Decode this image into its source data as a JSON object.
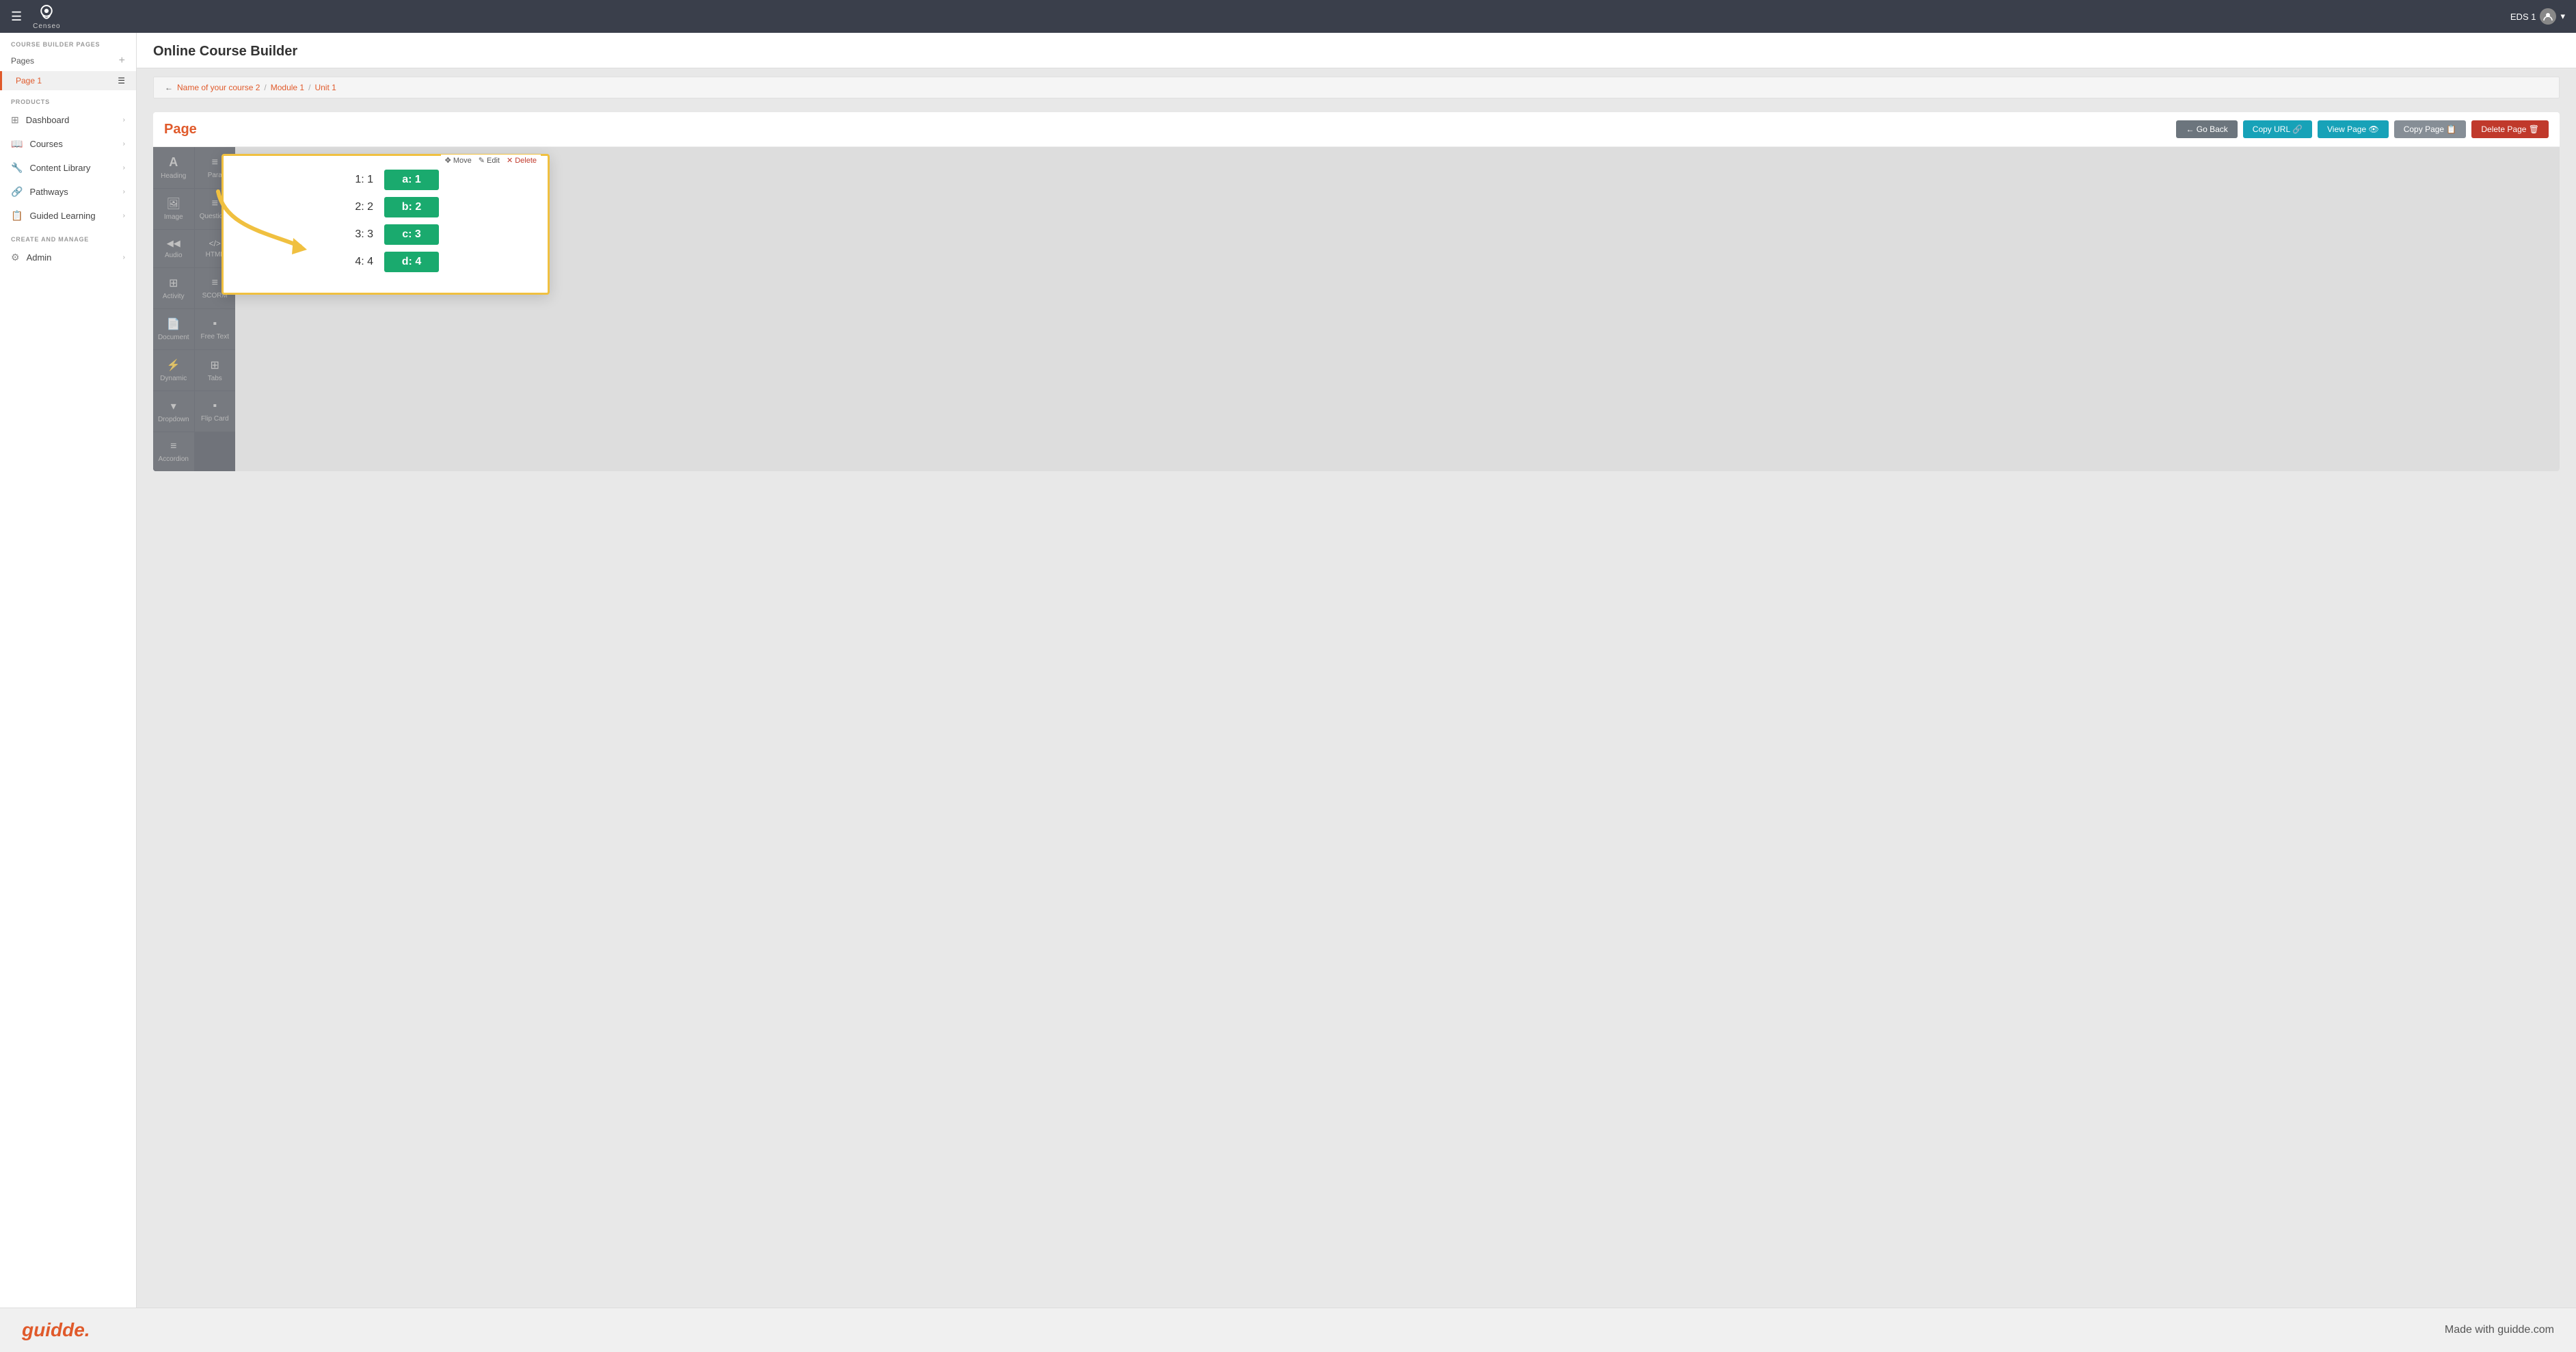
{
  "app": {
    "name": "Censeo",
    "hamburger_icon": "☰"
  },
  "topnav": {
    "user_label": "EDS 1",
    "dropdown_icon": "▾"
  },
  "sidebar": {
    "section_course_builder": "Course Builder Pages",
    "pages_label": "Pages",
    "page1_label": "Page 1",
    "section_products": "Products",
    "section_create": "Create and Manage",
    "items": [
      {
        "id": "dashboard",
        "label": "Dashboard",
        "icon": "⊞"
      },
      {
        "id": "courses",
        "label": "Courses",
        "icon": "📖"
      },
      {
        "id": "content-library",
        "label": "Content Library",
        "icon": "🔧"
      },
      {
        "id": "pathways",
        "label": "Pathways",
        "icon": "🔗"
      },
      {
        "id": "guided-learning",
        "label": "Guided Learning",
        "icon": "📋"
      },
      {
        "id": "admin",
        "label": "Admin",
        "icon": "⚙"
      }
    ]
  },
  "breadcrumb": {
    "back_icon": "←",
    "parts": [
      {
        "label": "Name of your course 2",
        "link": true
      },
      {
        "label": "Module 1",
        "link": true
      },
      {
        "label": "Unit 1",
        "link": true
      }
    ],
    "separator": "/"
  },
  "content": {
    "page_header": "Online Course Builder"
  },
  "page_section": {
    "title": "Page",
    "buttons": [
      {
        "id": "go-back",
        "label": "← Go Back",
        "style": "default"
      },
      {
        "id": "copy-url",
        "label": "Copy URL 🔗",
        "style": "info"
      },
      {
        "id": "view-page",
        "label": "View Page 👁",
        "style": "info"
      },
      {
        "id": "copy-page",
        "label": "Copy Page 📋",
        "style": "secondary"
      },
      {
        "id": "delete-page",
        "label": "Delete Page 🗑",
        "style": "danger"
      }
    ]
  },
  "tools": [
    {
      "id": "heading",
      "label": "Heading",
      "icon": "A"
    },
    {
      "id": "para",
      "label": "Para",
      "icon": "≡"
    },
    {
      "id": "image",
      "label": "Image",
      "icon": "🖼"
    },
    {
      "id": "questions",
      "label": "Questions",
      "icon": "≡"
    },
    {
      "id": "audio",
      "label": "Audio",
      "icon": "◀◀"
    },
    {
      "id": "html",
      "label": "HTML",
      "icon": "<>"
    },
    {
      "id": "activity",
      "label": "Activity",
      "icon": "⊞"
    },
    {
      "id": "scorm",
      "label": "SCORM",
      "icon": "≡"
    },
    {
      "id": "document",
      "label": "Document",
      "icon": "📄"
    },
    {
      "id": "free-text",
      "label": "Free Text",
      "icon": "▪"
    },
    {
      "id": "dynamic",
      "label": "Dynamic",
      "icon": "⚡"
    },
    {
      "id": "tabs",
      "label": "Tabs",
      "icon": "⊞"
    },
    {
      "id": "dropdown",
      "label": "Dropdown",
      "icon": "▾"
    },
    {
      "id": "flip-card",
      "label": "Flip Card",
      "icon": "▪"
    },
    {
      "id": "accordion",
      "label": "Accordion",
      "icon": "≡"
    }
  ],
  "activity": {
    "toolbar": {
      "move": "Move",
      "edit": "Edit",
      "delete": "Delete",
      "move_icon": "✥",
      "edit_icon": "✎",
      "delete_icon": "✕"
    },
    "rows": [
      {
        "left": "1:  1",
        "right": "a:  1"
      },
      {
        "left": "2:  2",
        "right": "b:  2"
      },
      {
        "left": "3:  3",
        "right": "c:  3"
      },
      {
        "left": "4:  4",
        "right": "d:  4"
      }
    ]
  },
  "footer": {
    "logo": "guidde.",
    "tagline": "Made with guidde.com"
  },
  "colors": {
    "accent_orange": "#e05a2b",
    "accent_green": "#1aaa6e",
    "nav_dark": "#3a3f4b",
    "btn_danger": "#c0392b",
    "arrow_yellow": "#f0c040"
  }
}
